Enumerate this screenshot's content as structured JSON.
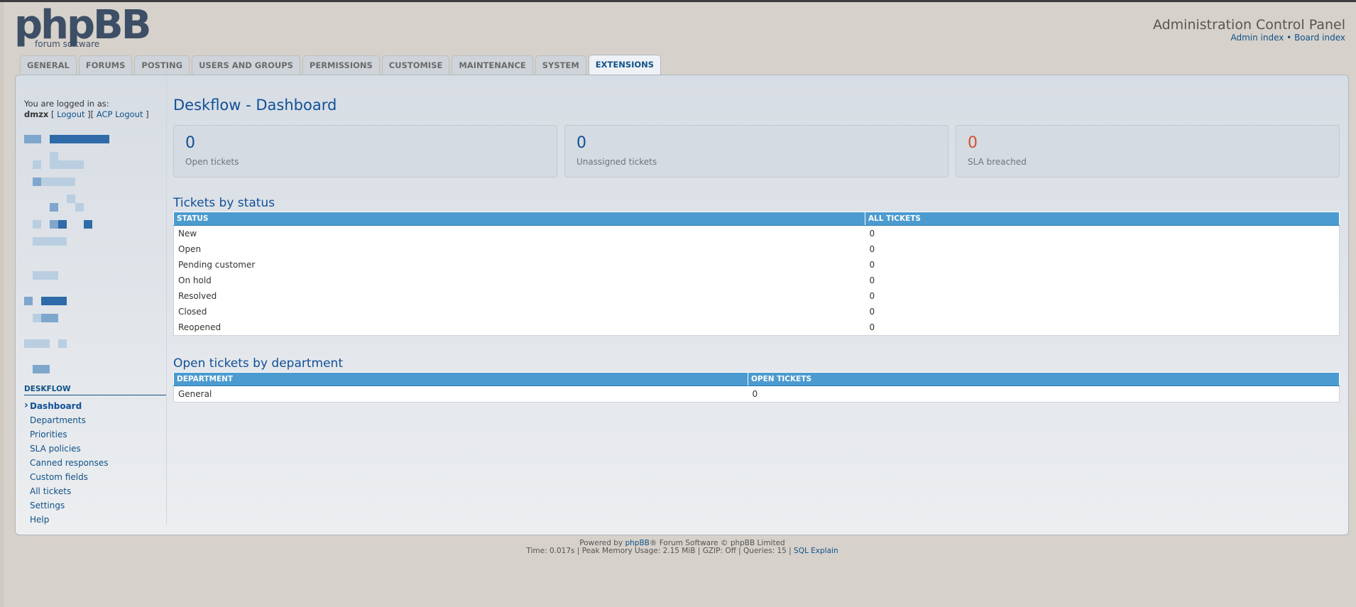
{
  "header": {
    "logo_main": "phpBB",
    "logo_sub": "forum software",
    "acp_title": "Administration Control Panel",
    "admin_index": "Admin index",
    "separator": "•",
    "board_index": "Board index"
  },
  "tabs": [
    {
      "label": "GENERAL"
    },
    {
      "label": "FORUMS"
    },
    {
      "label": "POSTING"
    },
    {
      "label": "USERS AND GROUPS"
    },
    {
      "label": "PERMISSIONS"
    },
    {
      "label": "CUSTOMISE"
    },
    {
      "label": "MAINTENANCE"
    },
    {
      "label": "SYSTEM"
    },
    {
      "label": "EXTENSIONS",
      "active": true
    }
  ],
  "sidebar": {
    "logged_in_label": "You are logged in as:",
    "username": "dmzx",
    "logout_open": " [ ",
    "logout": "Logout",
    "logout_close": " ][ ",
    "acp_logout": "ACP Logout",
    "acp_logout_close": " ]",
    "module_title": "DESKFLOW",
    "menu": [
      {
        "label": "Dashboard",
        "active": true
      },
      {
        "label": "Departments"
      },
      {
        "label": "Priorities"
      },
      {
        "label": "SLA policies"
      },
      {
        "label": "Canned responses"
      },
      {
        "label": "Custom fields"
      },
      {
        "label": "All tickets"
      },
      {
        "label": "Settings"
      },
      {
        "label": "Help"
      }
    ]
  },
  "main": {
    "title": "Deskflow - Dashboard",
    "cards": [
      {
        "value": "0",
        "label": "Open tickets",
        "color": "#115098"
      },
      {
        "value": "0",
        "label": "Unassigned tickets",
        "color": "#115098"
      },
      {
        "value": "0",
        "label": "SLA breached",
        "color": "#d0502f"
      }
    ],
    "status_section": {
      "title": "Tickets by status",
      "col1": "STATUS",
      "col2": "ALL TICKETS",
      "rows": [
        {
          "status": "New",
          "count": "0"
        },
        {
          "status": "Open",
          "count": "0"
        },
        {
          "status": "Pending customer",
          "count": "0"
        },
        {
          "status": "On hold",
          "count": "0"
        },
        {
          "status": "Resolved",
          "count": "0"
        },
        {
          "status": "Closed",
          "count": "0"
        },
        {
          "status": "Reopened",
          "count": "0"
        }
      ]
    },
    "department_section": {
      "title": "Open tickets by department",
      "col1": "DEPARTMENT",
      "col2": "OPEN TICKETS",
      "rows": [
        {
          "department": "General",
          "count": "0"
        }
      ]
    }
  },
  "footer": {
    "powered_prefix": "Powered by ",
    "phpbb_link": "phpBB",
    "powered_suffix": "® Forum Software © phpBB Limited",
    "stats": "Time: 0.017s | Peak Memory Usage: 2.15 MiB | GZIP: Off | Queries: 15 | ",
    "sql_explain": "SQL Explain"
  }
}
